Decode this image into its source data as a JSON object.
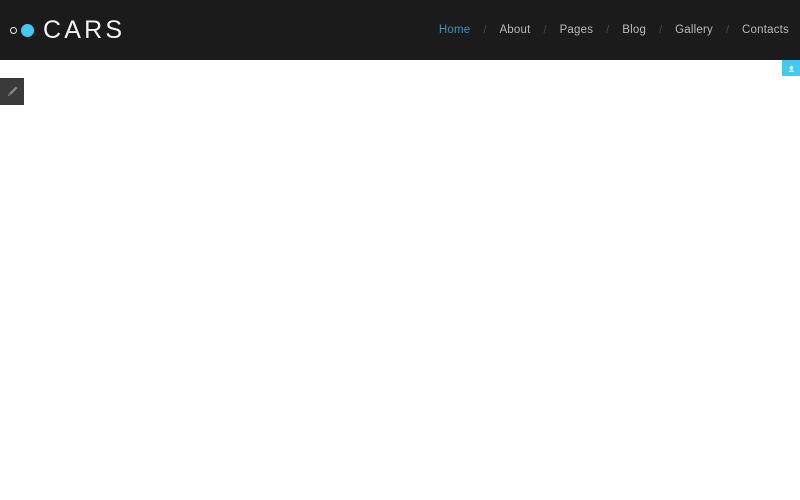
{
  "header": {
    "background_color": "#1b1b1b",
    "brand": {
      "name": "CARS",
      "mark_ring_icon": "circle-outline-icon",
      "mark_dot_icon": "circle-filled-icon",
      "accent_color": "#45c8f0"
    },
    "nav": {
      "separator": "/",
      "active_color": "#3d92b5",
      "items": [
        {
          "label": "Home",
          "active": true
        },
        {
          "label": "About",
          "active": false
        },
        {
          "label": "Pages",
          "active": false
        },
        {
          "label": "Blog",
          "active": false
        },
        {
          "label": "Gallery",
          "active": false
        },
        {
          "label": "Contacts",
          "active": false
        }
      ]
    }
  },
  "corner_action": {
    "icon": "upload-arrow-icon",
    "label": "",
    "background_color": "#45c8f0"
  },
  "edit_tab": {
    "icon": "pencil-icon",
    "label": "",
    "background_color": "#3a3a3a"
  },
  "page_body": {
    "background_color": "#ffffff",
    "content": ""
  }
}
